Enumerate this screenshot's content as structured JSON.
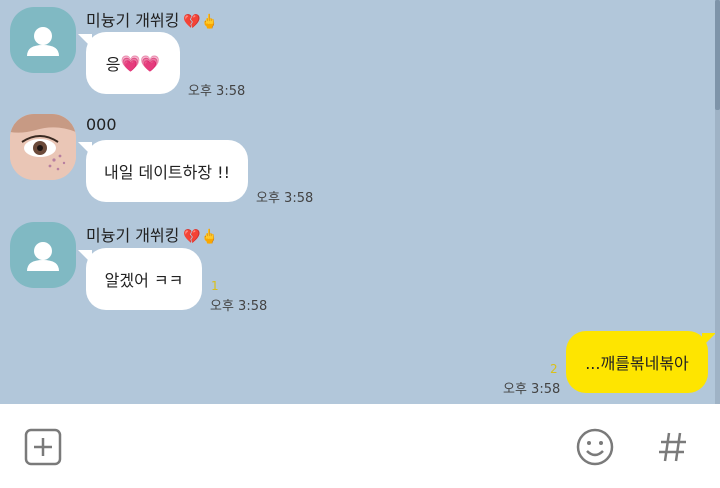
{
  "messages": [
    {
      "sender": "미늉기 개쒸킹",
      "sender_emoji": "💔🖕",
      "text": "응",
      "text_emoji": "💗💗",
      "time": "오후 3:58"
    },
    {
      "sender": "000",
      "text": "내일 데이트하장 !!",
      "time": "오후 3:58"
    },
    {
      "sender": "미늉기 개쒸킹",
      "sender_emoji": "💔🖕",
      "text": "알겠어 ㅋㅋ",
      "unread": "1",
      "time": "오후 3:58"
    },
    {
      "text": "...깨를볶네볶아",
      "unread": "2",
      "time": "오후 3:58",
      "outgoing": true
    }
  ],
  "input_bar": {
    "add_icon": "plus-square-icon",
    "emoji_icon": "smiley-icon",
    "hash_icon": "hash-icon"
  },
  "colors": {
    "chat_bg": "#b2c7da",
    "outgoing_bubble": "#fee500",
    "incoming_bubble": "#ffffff",
    "default_avatar": "#80b9c3"
  }
}
